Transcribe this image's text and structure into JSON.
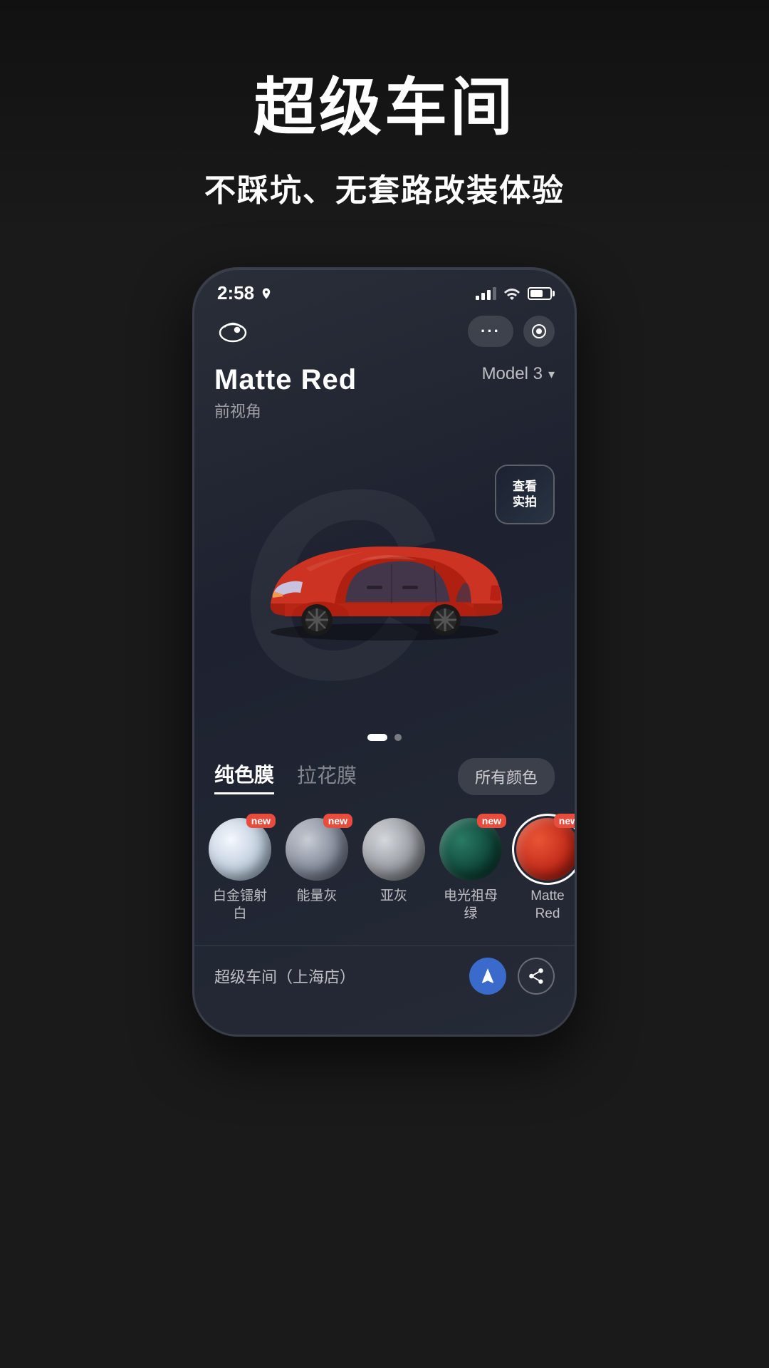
{
  "hero": {
    "title": "超级车间",
    "subtitle": "不踩坑、无套路改装体验"
  },
  "phone": {
    "status": {
      "time": "2:58",
      "location_arrow": "↗"
    },
    "header": {
      "more_btn": "···",
      "record_btn": "⊙"
    },
    "car": {
      "name": "Matte Red",
      "view": "前视角",
      "model": "Model 3",
      "real_photo_btn_line1": "查看",
      "real_photo_btn_line2": "实拍",
      "bg_letter": "C"
    },
    "tabs": {
      "items": [
        {
          "label": "纯色膜",
          "active": true
        },
        {
          "label": "拉花膜",
          "active": false
        }
      ],
      "all_colors": "所有颜色"
    },
    "swatches": [
      {
        "id": "platinum",
        "label": "白金镭射\n白",
        "color": "#e8eef5",
        "has_new": true,
        "selected": false,
        "gradient": "radial-gradient(circle at 35% 35%, #f5f8ff, #b8c8d8 60%, #8aa0b5)"
      },
      {
        "id": "energy_grey",
        "label": "能量灰",
        "color": "#9a9fa8",
        "has_new": true,
        "selected": false,
        "gradient": "radial-gradient(circle at 35% 35%, #c8cdd5, #7a8090 60%, #5a6070)"
      },
      {
        "id": "sub_grey",
        "label": "亚灰",
        "color": "#b0b5bc",
        "has_new": false,
        "selected": false,
        "gradient": "radial-gradient(circle at 35% 35%, #d5d8dd, #8e9298 60%, #6e7278)"
      },
      {
        "id": "electric_green",
        "label": "电光祖母\n绿",
        "color": "#1a5a4a",
        "has_new": true,
        "selected": false,
        "gradient": "radial-gradient(circle at 35% 35%, #2a7a64, #0e4438 60%, #092c24)"
      },
      {
        "id": "matte_red",
        "label": "Matte\nRed",
        "color": "#cc3322",
        "has_new": true,
        "selected": true,
        "gradient": "radial-gradient(circle at 35% 35%, #e85535, #c02818 60%, #8a1810)"
      }
    ],
    "bottom": {
      "shop_name": "超级车间（上海店）"
    }
  }
}
